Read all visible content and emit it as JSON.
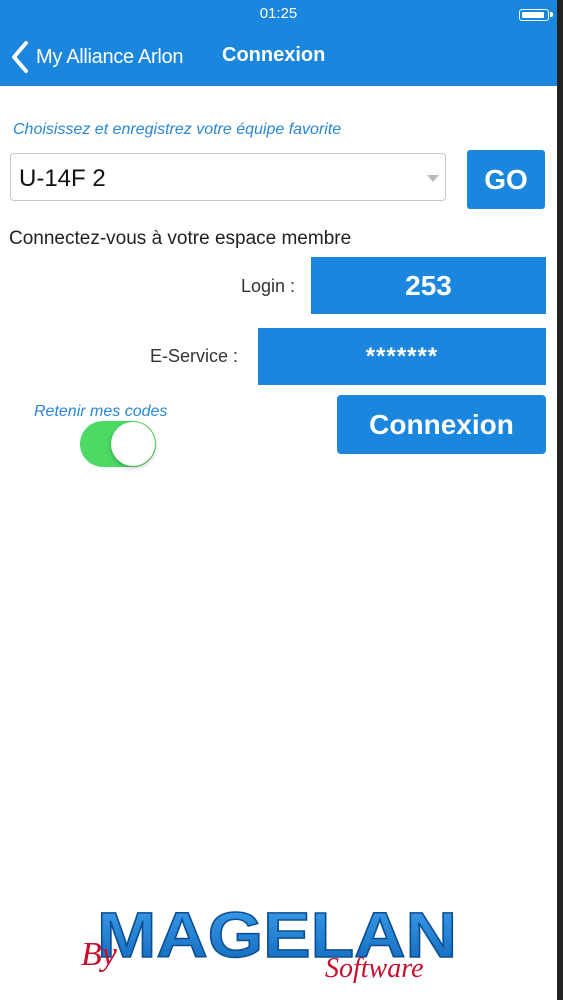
{
  "status": {
    "time": "01:25"
  },
  "nav": {
    "back_label": "My Alliance Arlon",
    "title": "Connexion"
  },
  "favorite": {
    "prompt": "Choisissez et enregistrez votre équipe favorite",
    "selected_team": "U-14F 2",
    "go_label": "GO"
  },
  "member": {
    "prompt": "Connectez-vous à votre espace membre",
    "login_label": "Login :",
    "login_value": "253",
    "eservice_label": "E-Service :",
    "eservice_value": "*******",
    "remember_label": "Retenir mes codes",
    "remember_on": true,
    "connect_label": "Connexion"
  },
  "logo": {
    "by": "By",
    "brand": "MAGELAN",
    "software": "Software"
  },
  "colors": {
    "primary": "#1a86dd",
    "link": "#2a86d6",
    "toggle_on": "#4cd964",
    "logo_red": "#c8102e"
  }
}
